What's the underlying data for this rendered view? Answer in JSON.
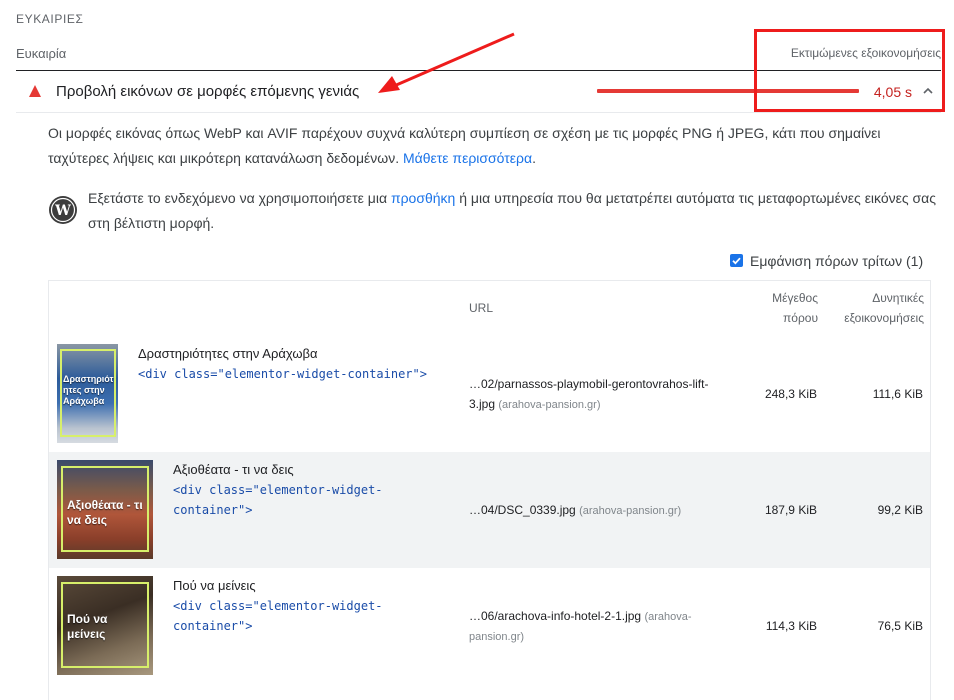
{
  "section": {
    "title": "ΕΥΚΑΙΡΙΕΣ"
  },
  "header": {
    "left": "Ευκαιρία",
    "right": "Εκτιμώμενες εξοικονομήσεις"
  },
  "audit": {
    "title": "Προβολή εικόνων σε μορφές επόμενης γενιάς",
    "value": "4,05 s",
    "status_icon": "triangle-fail-icon",
    "expand_icon": "chevron-up-icon",
    "description_text": "Οι μορφές εικόνας όπως WebP και AVIF παρέχουν συχνά καλύτερη συμπίεση σε σχέση με τις μορφές PNG ή JPEG, κάτι που σημαίνει ταχύτερες λήψεις και μικρότερη κατανάλωση δεδομένων.",
    "description_link": "Μάθετε περισσότερα",
    "description_end": ".",
    "wp_icon": "wordpress-icon",
    "wp_text_before": "Εξετάστε το ενδεχόμενο να χρησιμοποιήσετε μια",
    "wp_link": "προσθήκη",
    "wp_text_after": "ή μια υπηρεσία που θα μετατρέπει αυτόματα τις μεταφορτωμένες εικόνες σας στη βέλτιστη μορφή."
  },
  "third_party": {
    "label": "Εμφάνιση πόρων τρίτων (1)",
    "checked": true
  },
  "table": {
    "col_url": "URL",
    "col_size_1": "Μέγεθος",
    "col_size_2": "πόρου",
    "col_save_1": "Δυνητικές",
    "col_save_2": "εξοικονομήσεις",
    "rows": [
      {
        "label": "Δραστηριότητες στην Αράχωβα",
        "code": "<div class=\"elementor-widget-container\">",
        "thumb_text": "Δραστηριότ ητες στην Αράχωβα",
        "url_1": "…02/parnassos-playmobil-gerontovrahos-lift-",
        "url_2": "3.jpg",
        "origin": "(arahova-pansion.gr)",
        "size": "248,3 KiB",
        "savings": "111,6 KiB"
      },
      {
        "label": "Αξιοθέατα - τι να δεις",
        "code_1": "<div class=\"elementor-widget-",
        "code_2": "container\">",
        "thumb_text": "Αξιοθέατα - τι να δεις",
        "url_1": "…04/DSC_0339.jpg",
        "origin": "(arahova-pansion.gr)",
        "size": "187,9 KiB",
        "savings": "99,2 KiB"
      },
      {
        "label": "Πού να μείνεις",
        "code_1": "<div class=\"elementor-widget-",
        "code_2": "container\">",
        "thumb_text": "Πού να μείνεις",
        "url_1": "…06/arachova-info-hotel-2-1.jpg",
        "origin_1": "(arahova-",
        "origin_2": "pansion.gr)",
        "size": "114,3 KiB",
        "savings": "76,5 KiB"
      }
    ]
  },
  "colors": {
    "fail": "#e53935",
    "annotation": "#ee1c1c",
    "link": "#1a73e8",
    "code": "#1a4ca8",
    "highlight": "#d7ef6a"
  }
}
